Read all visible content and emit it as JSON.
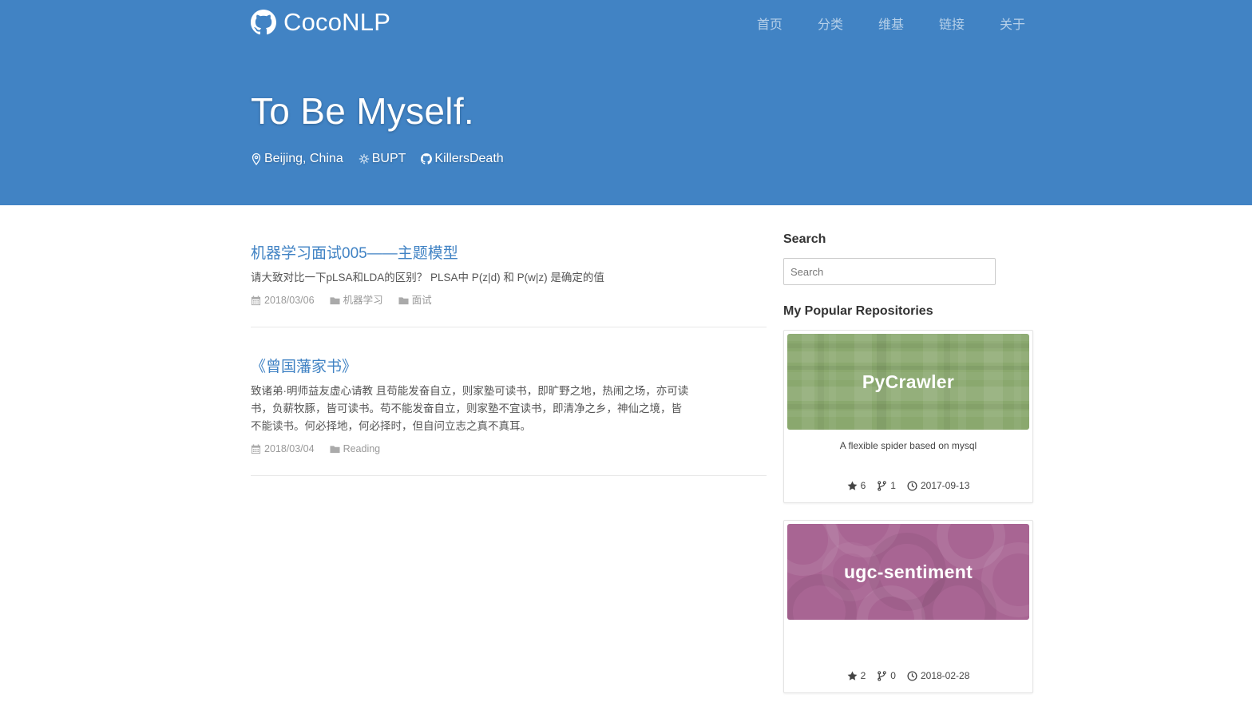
{
  "site": {
    "brand": "CocoNLP",
    "nav": [
      "首页",
      "分类",
      "维基",
      "链接",
      "关于"
    ],
    "hero_title": "To Be Myself.",
    "meta": {
      "location": "Beijing, China",
      "school": "BUPT",
      "github": "KillersDeath"
    }
  },
  "posts": [
    {
      "title": "机器学习面试005——主题模型",
      "excerpt": "请大致对比一下pLSA和LDA的区别？ PLSA中 P(z|d) 和 P(w|z) 是确定的值",
      "date": "2018/03/06",
      "categories": [
        "机器学习",
        "面试"
      ]
    },
    {
      "title": "《曾国藩家书》",
      "excerpt": "致诸弟·明师益友虚心请教 且苟能发奋自立，则家塾可读书，即旷野之地，热闹之场，亦可读书，负薪牧豚，皆可读书。苟不能发奋自立，则家塾不宜读书，即清净之乡，神仙之境，皆不能读书。何必择地，何必择时，但自问立志之真不真耳。",
      "date": "2018/03/04",
      "categories": [
        "Reading"
      ]
    }
  ],
  "sidebar": {
    "search_heading": "Search",
    "search_placeholder": "Search",
    "repos_heading": "My Popular Repositories",
    "repos": [
      {
        "name": "PyCrawler",
        "description": "A flexible spider based on mysql",
        "stars": "6",
        "forks": "1",
        "updated": "2017-09-13",
        "color": "#8aa86e"
      },
      {
        "name": "ugc-sentiment",
        "description": "",
        "stars": "2",
        "forks": "0",
        "updated": "2018-02-28",
        "color": "#a86593"
      }
    ]
  },
  "icons": {
    "brand": "github-icon",
    "location": "map-pin-icon",
    "school": "school-icon",
    "github": "github-icon",
    "date": "calendar-icon",
    "category": "folder-icon",
    "star": "star-icon",
    "fork": "fork-icon",
    "updated": "clock-icon"
  }
}
